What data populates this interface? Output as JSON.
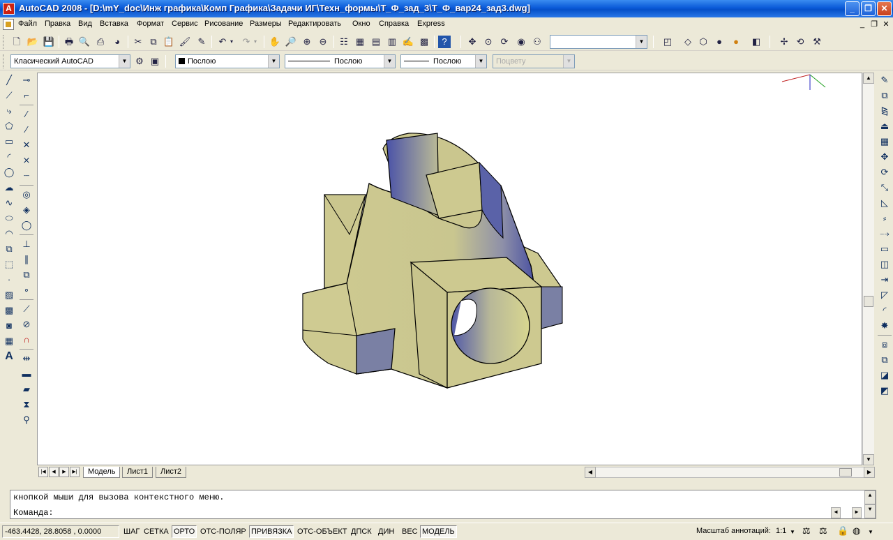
{
  "window": {
    "app_icon_letter": "A",
    "title": "AutoCAD 2008 - [D:\\mY_doc\\Инж графика\\Комп Графика\\Задачи ИГ\\Техн_формы\\Т_Ф_зад_3\\Т_Ф_вар24_зад3.dwg]",
    "buttons": {
      "minimize": "_",
      "maximize": "❐",
      "close": "✕"
    }
  },
  "menu": {
    "items": [
      "Файл",
      "Правка",
      "Вид",
      "Вставка",
      "Формат",
      "Сервис",
      "Рисование",
      "Размеры",
      "Редактировать",
      "Окно",
      "Справка",
      "Express"
    ],
    "doc_buttons": {
      "minimize": "_",
      "restore": "❐",
      "close": "✕"
    }
  },
  "toolbar2": {
    "workspace": "Класический AutoCAD",
    "color": "Послою",
    "linetype": "Послою",
    "lineweight": "Послою",
    "plotstyle": "Поцвету"
  },
  "tabs": {
    "items": [
      "Модель",
      "Лист1",
      "Лист2"
    ],
    "active": "Модель"
  },
  "command": {
    "history": "кнопкой мыши для вызова контекстного меню.",
    "prompt": "Команда:"
  },
  "status": {
    "coords": "-463.4428, 28.8058 , 0.0000",
    "toggles": [
      {
        "label": "ШАГ",
        "on": false
      },
      {
        "label": "СЕТКА",
        "on": false
      },
      {
        "label": "ОРТО",
        "on": true
      },
      {
        "label": "ОТС-ПОЛЯР",
        "on": false
      },
      {
        "label": "ПРИВЯЗКА",
        "on": true
      },
      {
        "label": "ОТС-ОБЪЕКТ",
        "on": false
      },
      {
        "label": "ДПСК",
        "on": false
      },
      {
        "label": "ДИН",
        "on": false
      },
      {
        "label": "ВЕС",
        "on": false
      },
      {
        "label": "МОДЕЛЬ",
        "on": true
      }
    ],
    "annotation_scale_label": "Масштаб аннотаций:",
    "annotation_scale_value": "1:1"
  },
  "colors": {
    "model_face": "#cdc990",
    "model_shadow": "#6f7aa8",
    "model_dark": "#3c44a0",
    "title_blue": "#0a5ad8"
  }
}
